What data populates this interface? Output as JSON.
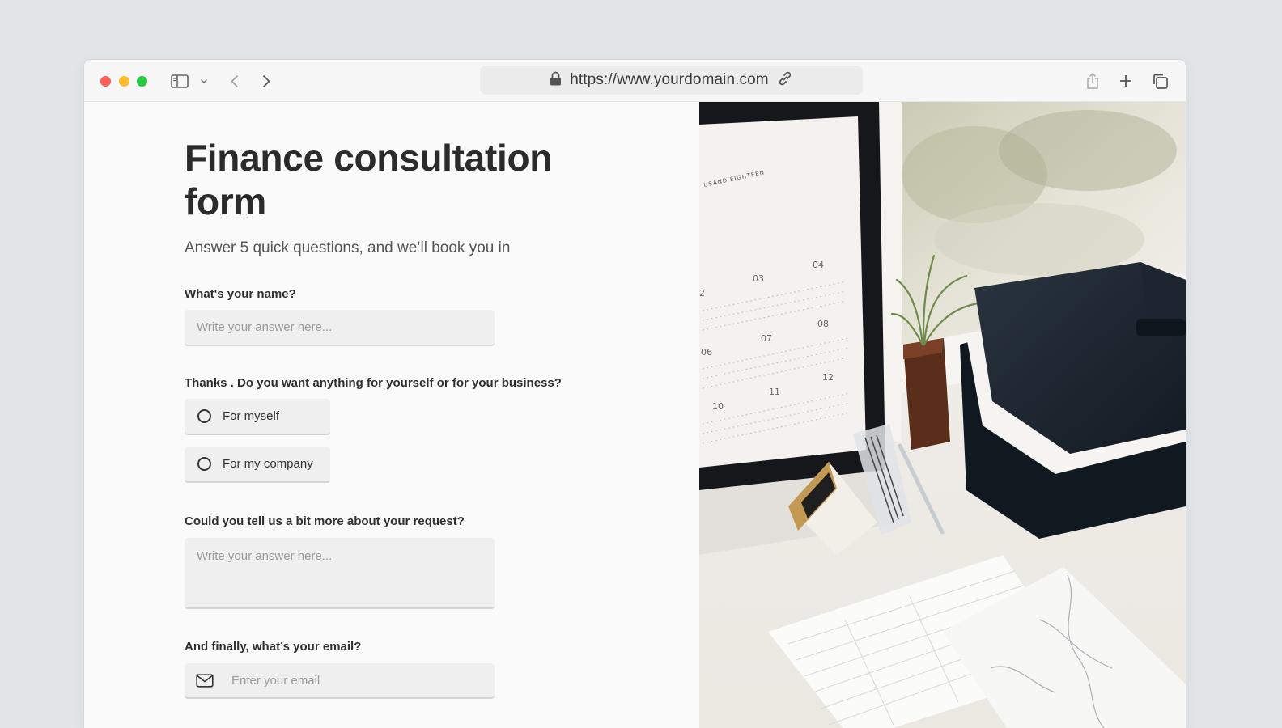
{
  "browser": {
    "url": "https://www.yourdomain.com",
    "icons": [
      "sidebar-icon",
      "chevron-down-icon",
      "back-icon",
      "forward-icon",
      "lock-icon",
      "link-icon",
      "share-icon",
      "plus-icon",
      "tabs-icon"
    ]
  },
  "form": {
    "title": "Finance consultation form",
    "subtitle": "Answer 5 quick questions, and we’ll book you in",
    "q1": {
      "label": "What's your name?",
      "placeholder": "Write your answer here..."
    },
    "q2": {
      "label": "Thanks . Do you want anything for yourself or for your business?",
      "options": [
        "For myself",
        "For my company"
      ]
    },
    "q3": {
      "label": "Could you tell us a bit more about your request?",
      "placeholder": "Write your answer here..."
    },
    "q4": {
      "label": "And finally, what’s your email?",
      "placeholder": "Enter your email"
    }
  },
  "photo": {
    "calendar": {
      "header": "USAND EIGHTEEN",
      "months": [
        "2",
        "03",
        "04",
        "06",
        "07",
        "08",
        "10",
        "11",
        "12"
      ]
    }
  },
  "colors": {
    "page_background": "#e2e5e8",
    "traffic_red": "#fe5f57",
    "traffic_yellow": "#febc2e",
    "traffic_green": "#28c840",
    "field_background": "#efefef"
  }
}
